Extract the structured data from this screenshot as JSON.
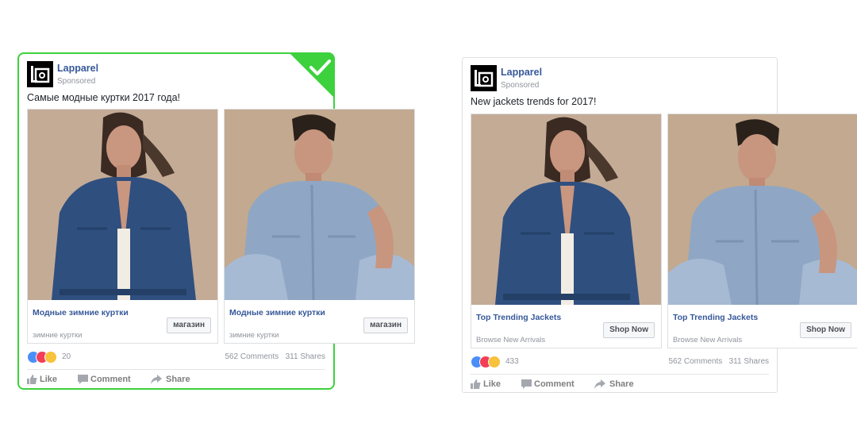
{
  "brand_color": "#365899",
  "highlight_color": "#3dd13d",
  "ads": {
    "left": {
      "page_name": "Lapparel",
      "sponsored": "Sponsored",
      "post_text": "Самые модные куртки 2017 года!",
      "cards": [
        {
          "title": "Модные зимние куртки",
          "subtitle": "зимние куртки",
          "cta": "магазин"
        },
        {
          "title": "Модные зимние куртки",
          "subtitle": "зимние куртки",
          "cta": "магазин"
        }
      ],
      "reaction_count": "20",
      "comments": "562 Comments",
      "shares": "311 Shares",
      "actions": {
        "like": "Like",
        "comment": "Comment",
        "share": "Share"
      },
      "selected_icon": "checkmark-icon"
    },
    "right": {
      "page_name": "Lapparel",
      "sponsored": "Sponsored",
      "post_text": "New jackets trends for 2017!",
      "cards": [
        {
          "title": "Top Trending Jackets",
          "subtitle": "Browse New Arrivals",
          "cta": "Shop Now"
        },
        {
          "title": "Top Trending Jackets",
          "subtitle": "Browse New Arrivals",
          "cta": "Shop Now"
        }
      ],
      "reaction_count": "433",
      "comments": "562 Comments",
      "shares": "311 Shares",
      "actions": {
        "like": "Like",
        "comment": "Comment",
        "share": "Share"
      }
    }
  }
}
